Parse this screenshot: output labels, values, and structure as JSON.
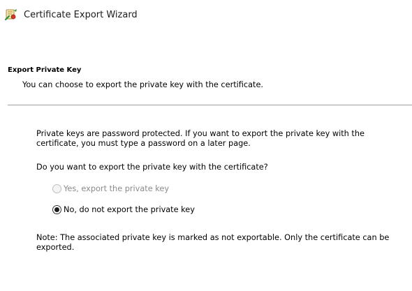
{
  "window": {
    "title": "Certificate Export Wizard",
    "icon": "certificate-wizard-icon"
  },
  "header": {
    "heading": "Export Private Key",
    "subtitle": "You can choose to export the private key with the certificate."
  },
  "content": {
    "intro": "Private keys are password protected. If you want to export the private key with the certificate, you must type a password on a later page.",
    "question": "Do you want to export the private key with the certificate?",
    "options": [
      {
        "label": "Yes, export the private key",
        "selected": false,
        "enabled": false
      },
      {
        "label": "No, do not export the private key",
        "selected": true,
        "enabled": true
      }
    ],
    "note": "Note: The associated private key is marked as not exportable. Only the certificate can be exported."
  },
  "colors": {
    "disabled_text": "#8a8a8a",
    "divider": "#a0a0a0"
  }
}
